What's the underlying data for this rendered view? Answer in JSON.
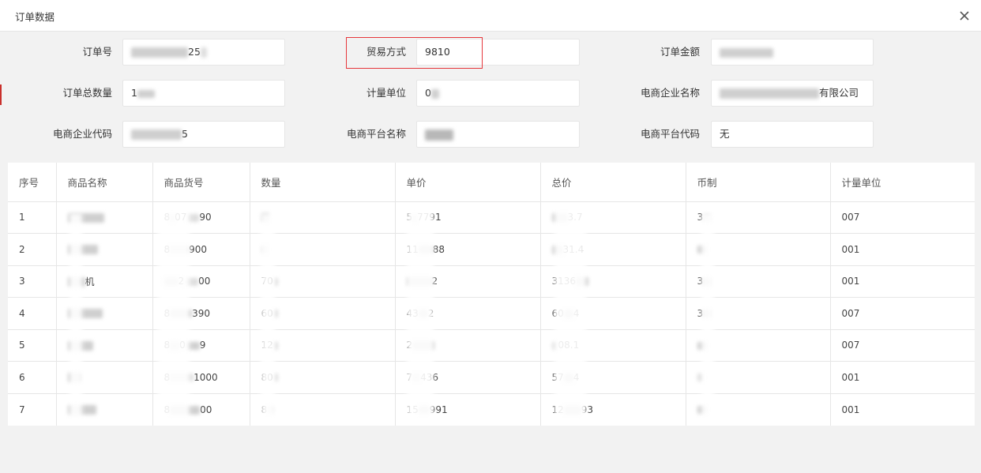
{
  "dialog": {
    "title": "订单数据"
  },
  "form": {
    "order_no": {
      "label": "订单号",
      "value_visible": "25"
    },
    "trade_mode": {
      "label": "贸易方式",
      "value": "9810"
    },
    "order_amount": {
      "label": "订单金额",
      "value_visible": ""
    },
    "order_total_qty": {
      "label": "订单总数量",
      "value_visible": "1"
    },
    "unit": {
      "label": "计量单位",
      "value_visible": "0"
    },
    "ecom_company_name": {
      "label": "电商企业名称",
      "value_visible": "有限公司"
    },
    "ecom_company_code": {
      "label": "电商企业代码",
      "value_visible": "5"
    },
    "ecom_platform_name": {
      "label": "电商平台名称",
      "value_visible": ""
    },
    "ecom_platform_code": {
      "label": "电商平台代码",
      "value": "无"
    }
  },
  "table": {
    "headers": [
      "序号",
      "商品名称",
      "商品货号",
      "数量",
      "单价",
      "总价",
      "币制",
      "计量单位"
    ],
    "rows": [
      {
        "seq": "1",
        "name": "",
        "sku_a": "8",
        "sku_b": "07",
        "sku_c": "90",
        "qty": "",
        "price_a": "5",
        "price_b": "7791",
        "total_a": "",
        "total_b": "3.7",
        "currency": "3",
        "unit": "007"
      },
      {
        "seq": "2",
        "name": "",
        "sku_a": "8",
        "sku_b": "",
        "sku_c": "900",
        "qty": "",
        "price_a": "11",
        "price_b": "88",
        "total_a": "",
        "total_b": "31.4",
        "currency": "",
        "unit": "001"
      },
      {
        "seq": "3",
        "name": "机",
        "sku_a": "",
        "sku_b": "2",
        "sku_c": "00",
        "qty": "70",
        "price_a": "",
        "price_b": "2",
        "total_a": "3136",
        "total_b": "",
        "currency": "3",
        "unit": "001"
      },
      {
        "seq": "4",
        "name": "",
        "sku_a": "8",
        "sku_b": "",
        "sku_c": "390",
        "qty": "60",
        "price_a": "43",
        "price_b": "2",
        "total_a": "60",
        "total_b": "4",
        "currency": "3",
        "unit": "007"
      },
      {
        "seq": "5",
        "name": "",
        "sku_a": "8",
        "sku_b": "0",
        "sku_c": "9",
        "qty": "12",
        "price_a": "2",
        "price_b": "",
        "total_a": "",
        "total_b": "08.1",
        "currency": "",
        "unit": "007"
      },
      {
        "seq": "6",
        "name": "",
        "sku_a": "8",
        "sku_b": "",
        "sku_c": "1000",
        "qty": "80",
        "price_a": "7",
        "price_b": "436",
        "total_a": "57",
        "total_b": "4",
        "currency": "",
        "unit": "001"
      },
      {
        "seq": "7",
        "name": "",
        "sku_a": "8",
        "sku_b": "",
        "sku_c": "00",
        "qty": "8",
        "price_a": "15",
        "price_b": "991",
        "total_a": "12",
        "total_b": "93",
        "currency": "",
        "unit": "001"
      }
    ]
  },
  "icons": {
    "close": "close-icon"
  },
  "colors": {
    "highlight": "#e6373c",
    "accent": "#c9302c"
  }
}
